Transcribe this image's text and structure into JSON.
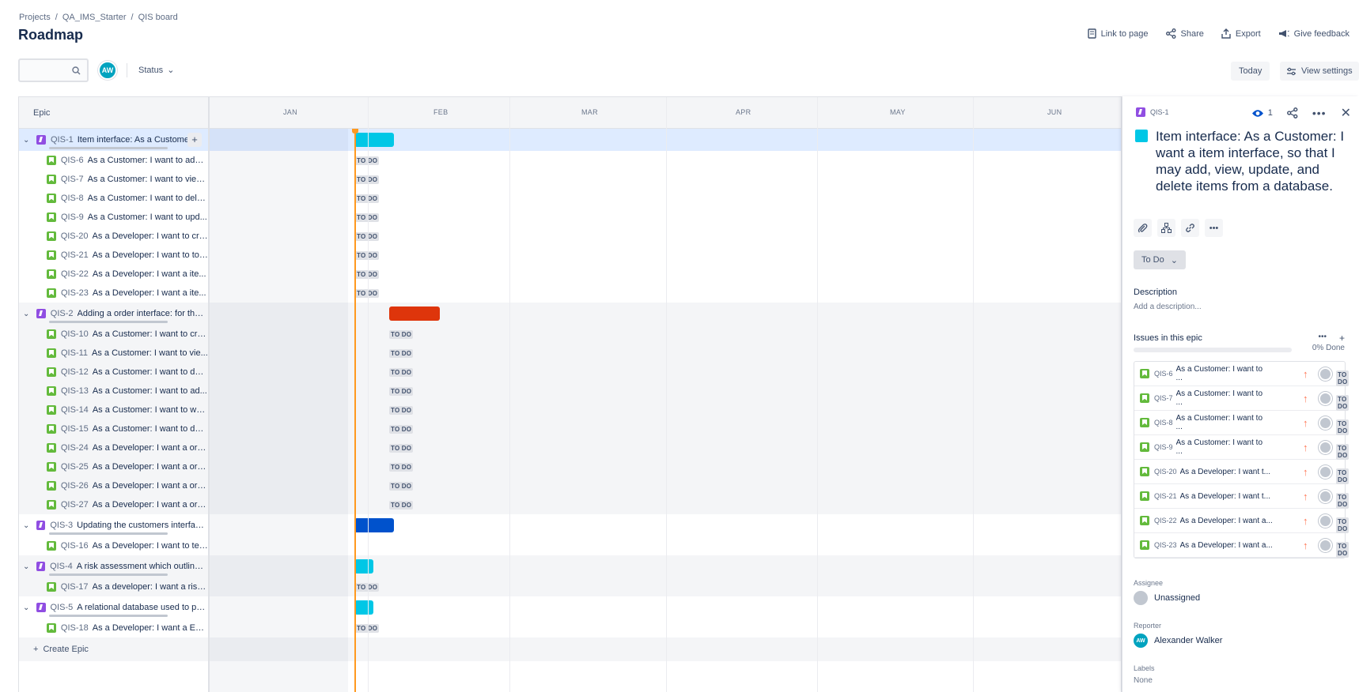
{
  "breadcrumb": [
    "Projects",
    "QA_IMS_Starter",
    "QIS board"
  ],
  "page_title": "Roadmap",
  "header_actions": {
    "link": "Link to page",
    "share": "Share",
    "export": "Export",
    "feedback": "Give feedback"
  },
  "toolbar": {
    "search_placeholder": "",
    "avatar_initials": "AW",
    "status_label": "Status",
    "today_label": "Today",
    "view_settings_label": "View settings"
  },
  "roadmap": {
    "epic_column_label": "Epic",
    "months": [
      "JAN",
      "FEB",
      "MAR",
      "APR",
      "MAY",
      "JUN"
    ],
    "create_epic_label": "Create Epic",
    "rows": [
      {
        "type": "epic",
        "key": "QIS-1",
        "summary": "Item interface: As a Customer...",
        "bar_color": "#00c7e6",
        "selected": true
      },
      {
        "type": "story",
        "key": "QIS-6",
        "summary": "As a Customer: I want to add ...",
        "status": "TO DO"
      },
      {
        "type": "story",
        "key": "QIS-7",
        "summary": "As a Customer: I want to view...",
        "status": "TO DO"
      },
      {
        "type": "story",
        "key": "QIS-8",
        "summary": "As a Customer: I want to dele...",
        "status": "TO DO"
      },
      {
        "type": "story",
        "key": "QIS-9",
        "summary": "As a Customer: I want to upd...",
        "status": "TO DO"
      },
      {
        "type": "story",
        "key": "QIS-20",
        "summary": "As a Developer: I want to cre...",
        "status": "TO DO"
      },
      {
        "type": "story",
        "key": "QIS-21",
        "summary": "As a Developer: I want to to ...",
        "status": "TO DO"
      },
      {
        "type": "story",
        "key": "QIS-22",
        "summary": "As a Developer: I want a ite...",
        "status": "TO DO"
      },
      {
        "type": "story",
        "key": "QIS-23",
        "summary": "As a Developer: I want a ite...",
        "status": "TO DO"
      },
      {
        "type": "epic",
        "key": "QIS-2",
        "summary": "Adding a order interface: for the ...",
        "bar_color": "#de350b"
      },
      {
        "type": "story",
        "key": "QIS-10",
        "summary": "As a Customer: I want to cre...",
        "status": "TO DO"
      },
      {
        "type": "story",
        "key": "QIS-11",
        "summary": "As a Customer: I want to vie...",
        "status": "TO DO"
      },
      {
        "type": "story",
        "key": "QIS-12",
        "summary": "As a Customer: I want to del...",
        "status": "TO DO"
      },
      {
        "type": "story",
        "key": "QIS-13",
        "summary": "As a Customer: I want to ad...",
        "status": "TO DO"
      },
      {
        "type": "story",
        "key": "QIS-14",
        "summary": "As a Customer: I want to wa...",
        "status": "TO DO"
      },
      {
        "type": "story",
        "key": "QIS-15",
        "summary": "As a Customer: I want to del...",
        "status": "TO DO"
      },
      {
        "type": "story",
        "key": "QIS-24",
        "summary": "As a Developer: I want a ord...",
        "status": "TO DO"
      },
      {
        "type": "story",
        "key": "QIS-25",
        "summary": "As a Developer: I want a ord...",
        "status": "TO DO"
      },
      {
        "type": "story",
        "key": "QIS-26",
        "summary": "As a Developer: I want a ord...",
        "status": "TO DO"
      },
      {
        "type": "story",
        "key": "QIS-27",
        "summary": "As a Developer: I want a ord...",
        "status": "TO DO"
      },
      {
        "type": "epic",
        "key": "QIS-3",
        "summary": "Updating the customers interface...",
        "bar_color": "#0052cc"
      },
      {
        "type": "story",
        "key": "QIS-16",
        "summary": "As a Developer: I want to tes...",
        "status": ""
      },
      {
        "type": "epic",
        "key": "QIS-4",
        "summary": "A risk assessment which outlines ...",
        "bar_color": "#00c7e6"
      },
      {
        "type": "story",
        "key": "QIS-17",
        "summary": "As a developer: I want a risk ...",
        "status": "TO DO"
      },
      {
        "type": "epic",
        "key": "QIS-5",
        "summary": "A relational database used to per...",
        "bar_color": "#00c7e6"
      },
      {
        "type": "story",
        "key": "QIS-18",
        "summary": "As a Developer: I want a ER...",
        "status": "TO DO"
      }
    ]
  },
  "panel": {
    "key": "QIS-1",
    "watch_count": "1",
    "title": "Item interface: As a Customer: I want a item interface, so that I may add, view, update, and delete items from a database.",
    "status": "To Do",
    "description_label": "Description",
    "description_placeholder": "Add a description...",
    "issues_label": "Issues in this epic",
    "progress_label": "0% Done",
    "progress": 0,
    "issues": [
      {
        "key": "QIS-6",
        "summary": "As a Customer: I want to ...",
        "status": "TO DO"
      },
      {
        "key": "QIS-7",
        "summary": "As a Customer: I want to ...",
        "status": "TO DO"
      },
      {
        "key": "QIS-8",
        "summary": "As a Customer: I want to ...",
        "status": "TO DO"
      },
      {
        "key": "QIS-9",
        "summary": "As a Customer: I want to ...",
        "status": "TO DO"
      },
      {
        "key": "QIS-20",
        "summary": "As a Developer: I want t...",
        "status": "TO DO"
      },
      {
        "key": "QIS-21",
        "summary": "As a Developer: I want t...",
        "status": "TO DO"
      },
      {
        "key": "QIS-22",
        "summary": "As a Developer: I want a...",
        "status": "TO DO"
      },
      {
        "key": "QIS-23",
        "summary": "As a Developer: I want a...",
        "status": "TO DO"
      }
    ],
    "assignee_label": "Assignee",
    "assignee": "Unassigned",
    "reporter_label": "Reporter",
    "reporter": "Alexander Walker",
    "reporter_initials": "AW",
    "labels_label": "Labels",
    "labels_value": "None"
  }
}
